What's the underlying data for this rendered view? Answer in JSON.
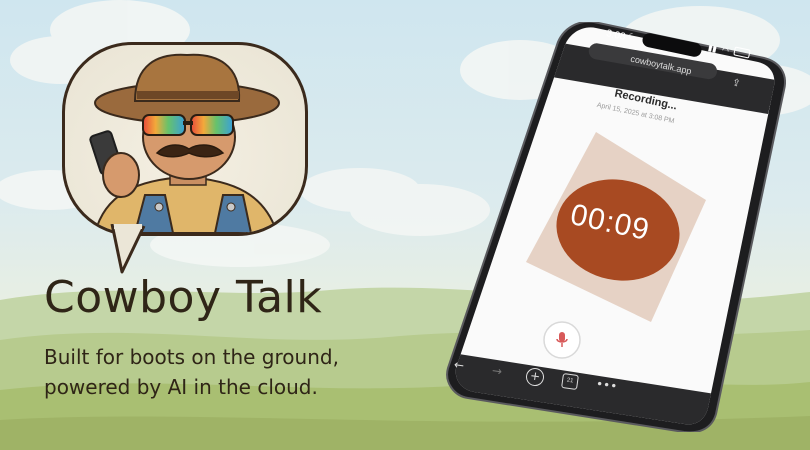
{
  "hero": {
    "title": "Cowboy Talk",
    "tagline_line1": "Built for boots on the ground,",
    "tagline_line2": "powered by AI in the cloud."
  },
  "phone": {
    "status_time": "3:08",
    "url": "cowboytalk.app",
    "recording_label": "Recording...",
    "recording_date": "April 15, 2025 at 3:08 PM",
    "timer": "00:09",
    "tabs_count": "21"
  },
  "colors": {
    "accent": "#a84a22",
    "diamond": "#e3cdbf",
    "text_dark": "#2f2517"
  },
  "icons": [
    "mic-icon",
    "share-icon",
    "back-icon",
    "forward-icon",
    "plus-icon",
    "tabs-icon",
    "more-icon",
    "moon-icon",
    "signal-icon",
    "wifi-icon",
    "battery-icon"
  ]
}
